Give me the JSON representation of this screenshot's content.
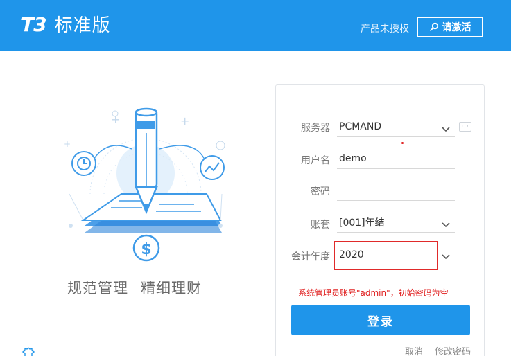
{
  "header": {
    "logo_mark": "T3",
    "logo_name": "标准版",
    "license_status": "产品未授权",
    "activate_label": "请激活"
  },
  "hero": {
    "slogan_left": "规范管理",
    "slogan_right": "精细理财"
  },
  "login": {
    "server_label": "服务器",
    "server_value": "PCMAND",
    "username_label": "用户名",
    "username_value": "demo",
    "password_label": "密码",
    "password_value": "",
    "account_label": "账套",
    "account_value": "[001]年结",
    "year_label": "会计年度",
    "year_value": "2020",
    "hint": "系统管理员账号\"admin\"，初始密码为空",
    "login_label": "登录",
    "cancel_label": "取消",
    "change_password_label": "修改密码"
  },
  "colors": {
    "brand": "#1f95ea",
    "hint": "#e02020",
    "highlight": "#e02a2a"
  }
}
